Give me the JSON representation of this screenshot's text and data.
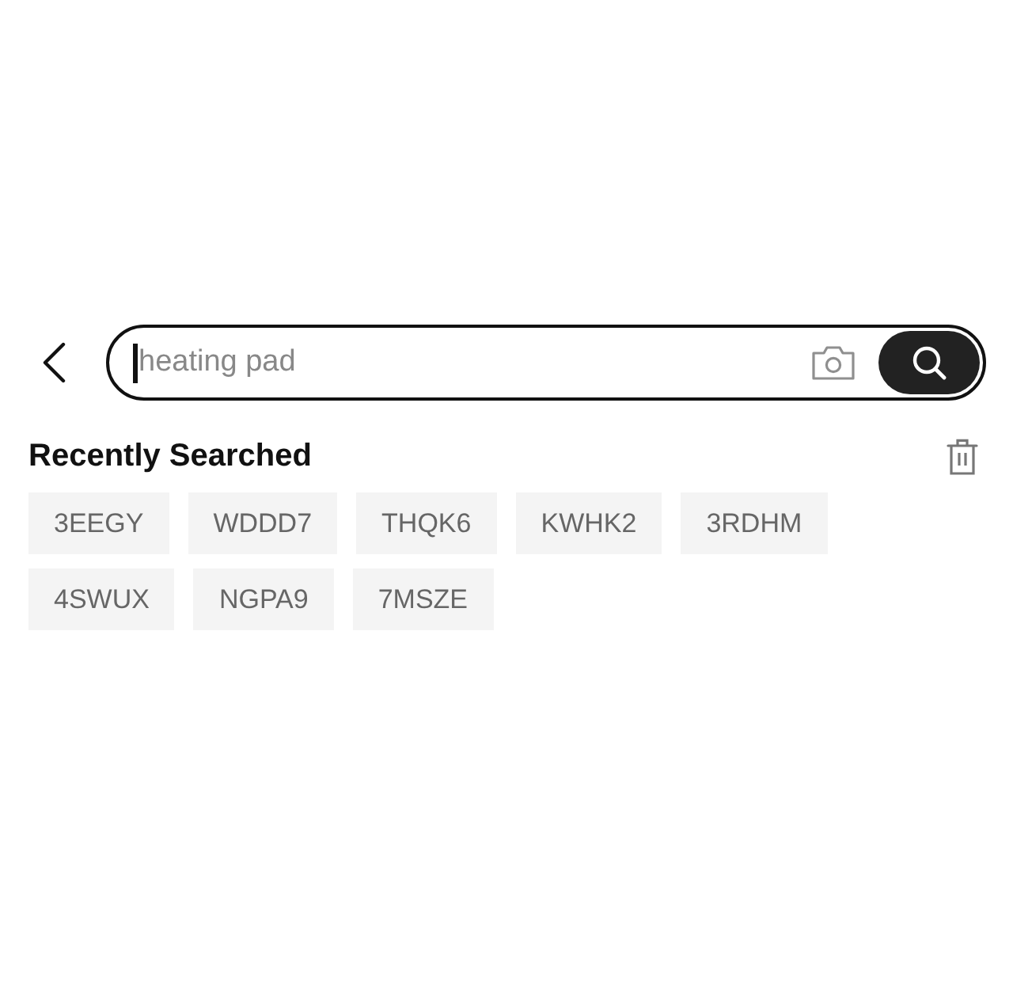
{
  "search_bar": {
    "placeholder": "heating pad",
    "focused": true
  },
  "recently_searched": {
    "title": "Recently Searched",
    "items": [
      "3EEGY",
      "WDDD7",
      "THQK6",
      "KWHK2",
      "3RDHM",
      "4SWUX",
      "NGPA9",
      "7MSZE"
    ]
  }
}
